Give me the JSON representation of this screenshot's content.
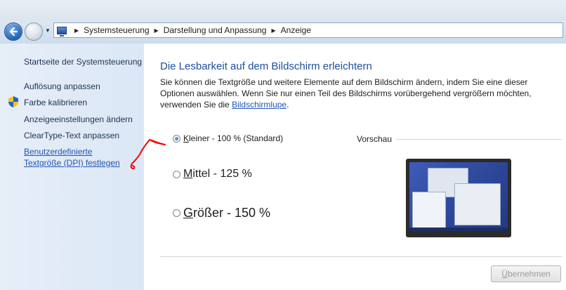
{
  "window": {
    "breadcrumbs": [
      "Systemsteuerung",
      "Darstellung und Anpassung",
      "Anzeige"
    ]
  },
  "sidebar": {
    "home": "Startseite der Systemsteuerung",
    "items": [
      {
        "label": "Auflösung anpassen"
      },
      {
        "label": "Farbe kalibrieren"
      },
      {
        "label": "Anzeigeeinstellungen ändern"
      },
      {
        "label": "ClearType-Text anpassen"
      },
      {
        "label": "Benutzerdefinierte Textgröße (DPI) festlegen"
      }
    ]
  },
  "main": {
    "title": "Die Lesbarkeit auf dem Bildschirm erleichtern",
    "description": "Sie können die Textgröße und weitere Elemente auf dem Bildschirm ändern, indem Sie eine dieser Optionen auswählen. Wenn Sie nur einen Teil des Bildschirms vorübergehend vergrößern möchten, verwenden Sie die ",
    "description_link": "Bildschirmlupe",
    "description_end": ".",
    "options": [
      {
        "first": "K",
        "rest": "leiner - 100 % (Standard)",
        "checked": true
      },
      {
        "first": "M",
        "rest": "ittel - 125 %",
        "checked": false
      },
      {
        "first": "G",
        "rest": "rößer - 150 %",
        "checked": false
      }
    ],
    "preview_label": "Vorschau",
    "apply_first": "Ü",
    "apply_rest": "bernehmen"
  },
  "colors": {
    "accent": "#1f4f9a",
    "link": "#1f56b4",
    "annotation": "#ff0000"
  }
}
